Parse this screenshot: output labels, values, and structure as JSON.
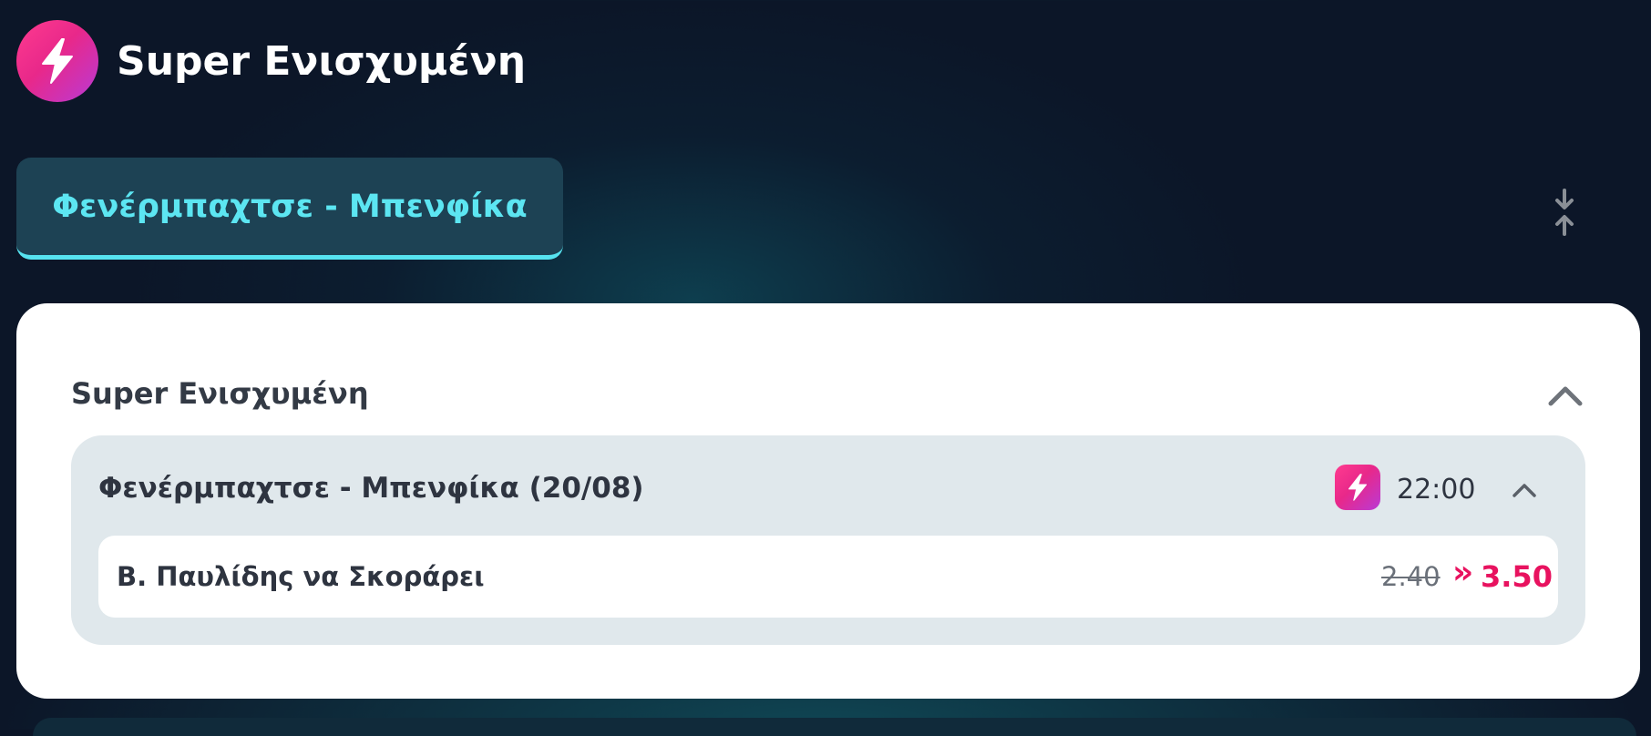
{
  "header": {
    "title": "Super Ενισχυμένη",
    "icon": "lightning-bolt-icon"
  },
  "tabs": [
    {
      "label": "Φενέρμπαχτσε - Μπενφίκα",
      "active": true
    }
  ],
  "toolbar": {
    "collapse_all_icon": "collapse-vertical-icon"
  },
  "section": {
    "title": "Super Ενισχυμένη",
    "expanded": true,
    "events": [
      {
        "title": "Φενέρμπαχτσε - Μπενφίκα (20/08)",
        "time": "22:00",
        "badge_icon": "lightning-bolt-icon",
        "expanded": true,
        "selections": [
          {
            "label": "Β. Παυλίδης να Σκοράρει",
            "old_odds": "2.40",
            "arrow": "»",
            "new_odds": "3.50"
          }
        ]
      }
    ]
  },
  "colors": {
    "background": "#0c1628",
    "accent_cyan": "#5ce6f2",
    "boost_pink": "#e8288a",
    "boost_purple": "#b93ad6",
    "odds_red": "#e8125f",
    "card_grey": "#e0e8ec"
  }
}
